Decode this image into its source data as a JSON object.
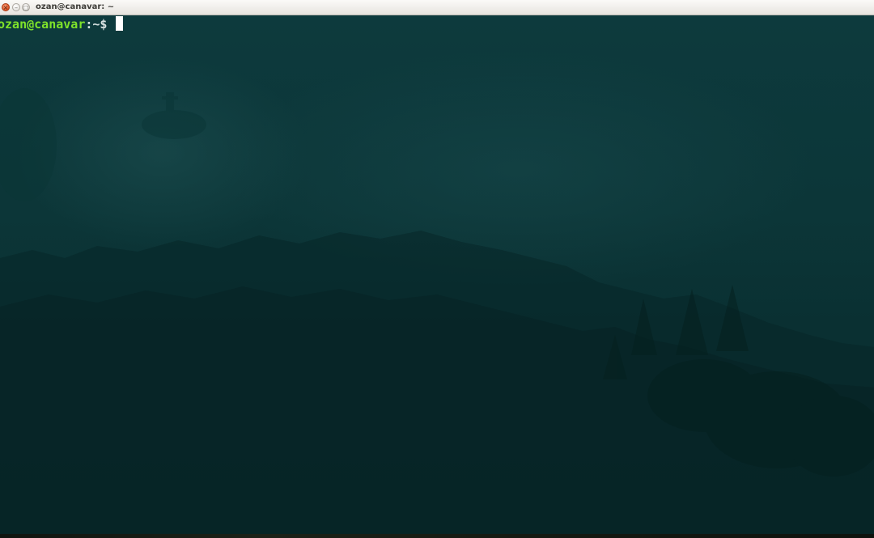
{
  "window": {
    "title": "ozan@canavar: ~",
    "buttons": {
      "close_glyph": "×",
      "minimize_glyph": "–",
      "maximize_glyph": "□"
    }
  },
  "terminal": {
    "prompt_user_host": "ozan@canavar",
    "prompt_path": ":~$ ",
    "background_color": "#0b2c2e",
    "prompt_color": "#7fe22a",
    "cursor_color": "#ffffff"
  }
}
